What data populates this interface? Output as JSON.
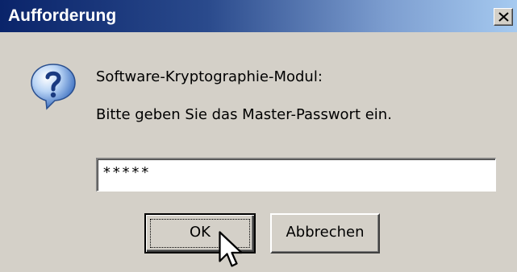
{
  "window": {
    "title": "Aufforderung",
    "close_icon": "close-icon"
  },
  "message": {
    "icon": "question-icon",
    "line1": "Software-Kryptographie-Modul:",
    "line2": "Bitte geben Sie das Master-Passwort ein."
  },
  "password_field": {
    "value": "*****"
  },
  "buttons": {
    "ok_label": "OK",
    "cancel_label": "Abbrechen"
  },
  "colors": {
    "titlebar_start": "#0a246a",
    "titlebar_end": "#a6caf0",
    "face": "#d4d0c8"
  }
}
